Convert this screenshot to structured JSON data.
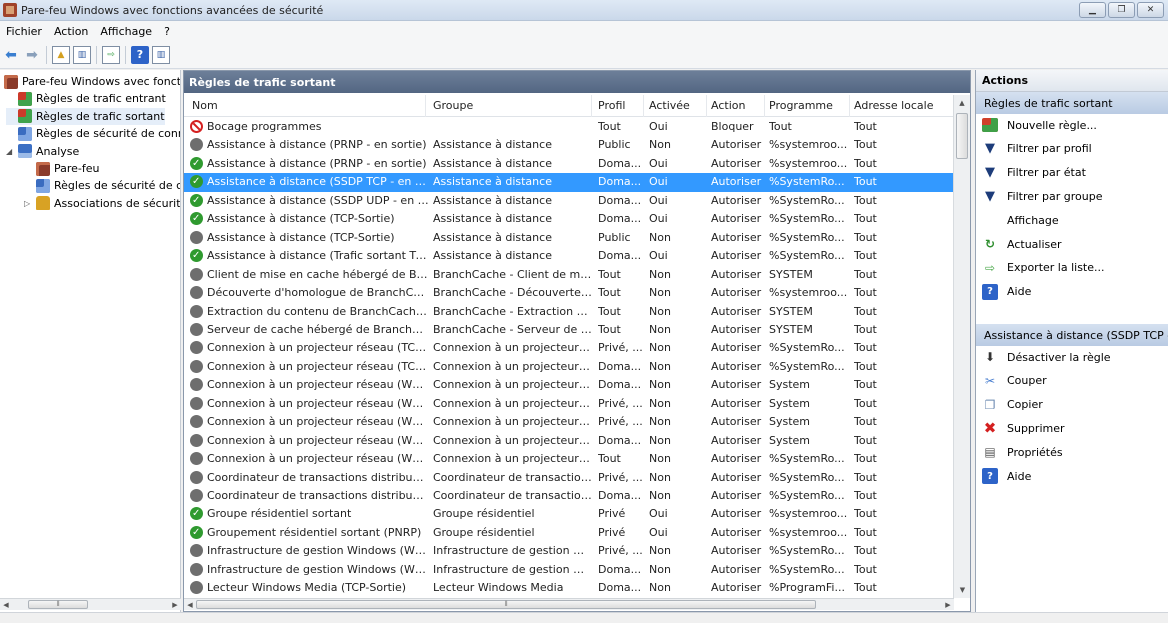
{
  "window": {
    "title": "Pare-feu Windows avec fonctions avancées de sécurité"
  },
  "menu": [
    "Fichier",
    "Action",
    "Affichage",
    "?"
  ],
  "tree": [
    {
      "label": "Pare-feu Windows avec fonctio",
      "icon": "firewall-icon",
      "level": 0,
      "expander": ""
    },
    {
      "label": "Règles de trafic entrant",
      "icon": "inbound-rules-icon",
      "level": 1,
      "expander": ""
    },
    {
      "label": "Règles de trafic sortant",
      "icon": "outbound-rules-icon",
      "level": 1,
      "expander": "",
      "selected": true
    },
    {
      "label": "Règles de sécurité de conne",
      "icon": "connection-security-icon",
      "level": 1,
      "expander": ""
    },
    {
      "label": "Analyse",
      "icon": "monitoring-icon",
      "level": 1,
      "expander": "◢"
    },
    {
      "label": "Pare-feu",
      "icon": "firewall-icon",
      "level": 2,
      "expander": ""
    },
    {
      "label": "Règles de sécurité de co",
      "icon": "connection-security-icon",
      "level": 2,
      "expander": ""
    },
    {
      "label": "Associations de sécurité",
      "icon": "lock-icon",
      "level": 2,
      "expander": "▷"
    }
  ],
  "center": {
    "title": "Règles de trafic sortant",
    "columns": [
      "Nom",
      "Groupe",
      "Profil",
      "Activée",
      "Action",
      "Programme",
      "Adresse locale"
    ],
    "rows": [
      {
        "status": "block",
        "name": "Bocage programmes",
        "group": "",
        "profile": "Tout",
        "enabled": "Oui",
        "action": "Bloquer",
        "program": "Tout",
        "local": "Tout"
      },
      {
        "status": "off",
        "name": "Assistance à distance (PRNP - en sortie)",
        "group": "Assistance à distance",
        "profile": "Public",
        "enabled": "Non",
        "action": "Autoriser",
        "program": "%systemroo...",
        "local": "Tout"
      },
      {
        "status": "on",
        "name": "Assistance à distance (PRNP - en sortie)",
        "group": "Assistance à distance",
        "profile": "Doma...",
        "enabled": "Oui",
        "action": "Autoriser",
        "program": "%systemroo...",
        "local": "Tout"
      },
      {
        "status": "on",
        "name": "Assistance à distance (SSDP TCP - en sort...",
        "group": "Assistance à distance",
        "profile": "Doma...",
        "enabled": "Oui",
        "action": "Autoriser",
        "program": "%SystemRo...",
        "local": "Tout",
        "selected": true
      },
      {
        "status": "on",
        "name": "Assistance à distance (SSDP UDP - en sor...",
        "group": "Assistance à distance",
        "profile": "Doma...",
        "enabled": "Oui",
        "action": "Autoriser",
        "program": "%SystemRo...",
        "local": "Tout"
      },
      {
        "status": "on",
        "name": "Assistance à distance (TCP-Sortie)",
        "group": "Assistance à distance",
        "profile": "Doma...",
        "enabled": "Oui",
        "action": "Autoriser",
        "program": "%SystemRo...",
        "local": "Tout"
      },
      {
        "status": "off",
        "name": "Assistance à distance (TCP-Sortie)",
        "group": "Assistance à distance",
        "profile": "Public",
        "enabled": "Non",
        "action": "Autoriser",
        "program": "%SystemRo...",
        "local": "Tout"
      },
      {
        "status": "on",
        "name": "Assistance à distance (Trafic sortant TCP ...",
        "group": "Assistance à distance",
        "profile": "Doma...",
        "enabled": "Oui",
        "action": "Autoriser",
        "program": "%SystemRo...",
        "local": "Tout"
      },
      {
        "status": "off",
        "name": "Client de mise en cache hébergé de Bran...",
        "group": "BranchCache - Client de mi...",
        "profile": "Tout",
        "enabled": "Non",
        "action": "Autoriser",
        "program": "SYSTEM",
        "local": "Tout"
      },
      {
        "status": "off",
        "name": "Découverte d'homologue de BranchCac...",
        "group": "BranchCache - Découverte ...",
        "profile": "Tout",
        "enabled": "Non",
        "action": "Autoriser",
        "program": "%systemroo...",
        "local": "Tout"
      },
      {
        "status": "off",
        "name": "Extraction du contenu de BranchCache (...",
        "group": "BranchCache - Extraction d...",
        "profile": "Tout",
        "enabled": "Non",
        "action": "Autoriser",
        "program": "SYSTEM",
        "local": "Tout"
      },
      {
        "status": "off",
        "name": "Serveur de cache hébergé de BranchCac...",
        "group": "BranchCache - Serveur de c...",
        "profile": "Tout",
        "enabled": "Non",
        "action": "Autoriser",
        "program": "SYSTEM",
        "local": "Tout"
      },
      {
        "status": "off",
        "name": "Connexion à un projecteur réseau (TCP-S...",
        "group": "Connexion à un projecteur r...",
        "profile": "Privé, ...",
        "enabled": "Non",
        "action": "Autoriser",
        "program": "%SystemRo...",
        "local": "Tout"
      },
      {
        "status": "off",
        "name": "Connexion à un projecteur réseau (TCP-S...",
        "group": "Connexion à un projecteur r...",
        "profile": "Doma...",
        "enabled": "Non",
        "action": "Autoriser",
        "program": "%SystemRo...",
        "local": "Tout"
      },
      {
        "status": "off",
        "name": "Connexion à un projecteur réseau (WSD ...",
        "group": "Connexion à un projecteur r...",
        "profile": "Doma...",
        "enabled": "Non",
        "action": "Autoriser",
        "program": "System",
        "local": "Tout"
      },
      {
        "status": "off",
        "name": "Connexion à un projecteur réseau (WSD ...",
        "group": "Connexion à un projecteur r...",
        "profile": "Privé, ...",
        "enabled": "Non",
        "action": "Autoriser",
        "program": "System",
        "local": "Tout"
      },
      {
        "status": "off",
        "name": "Connexion à un projecteur réseau (WSD ...",
        "group": "Connexion à un projecteur r...",
        "profile": "Privé, ...",
        "enabled": "Non",
        "action": "Autoriser",
        "program": "System",
        "local": "Tout"
      },
      {
        "status": "off",
        "name": "Connexion à un projecteur réseau (WSD ...",
        "group": "Connexion à un projecteur r...",
        "profile": "Doma...",
        "enabled": "Non",
        "action": "Autoriser",
        "program": "System",
        "local": "Tout"
      },
      {
        "status": "off",
        "name": "Connexion à un projecteur réseau (WSD-...",
        "group": "Connexion à un projecteur r...",
        "profile": "Tout",
        "enabled": "Non",
        "action": "Autoriser",
        "program": "%SystemRo...",
        "local": "Tout"
      },
      {
        "status": "off",
        "name": "Coordinateur de transactions distribuées ...",
        "group": "Coordinateur de transaction...",
        "profile": "Privé, ...",
        "enabled": "Non",
        "action": "Autoriser",
        "program": "%SystemRo...",
        "local": "Tout"
      },
      {
        "status": "off",
        "name": "Coordinateur de transactions distribuées ...",
        "group": "Coordinateur de transaction...",
        "profile": "Doma...",
        "enabled": "Non",
        "action": "Autoriser",
        "program": "%SystemRo...",
        "local": "Tout"
      },
      {
        "status": "on",
        "name": "Groupe résidentiel sortant",
        "group": "Groupe résidentiel",
        "profile": "Privé",
        "enabled": "Oui",
        "action": "Autoriser",
        "program": "%systemroo...",
        "local": "Tout"
      },
      {
        "status": "on",
        "name": "Groupement résidentiel sortant (PNRP)",
        "group": "Groupe résidentiel",
        "profile": "Privé",
        "enabled": "Oui",
        "action": "Autoriser",
        "program": "%systemroo...",
        "local": "Tout"
      },
      {
        "status": "off",
        "name": "Infrastructure de gestion Windows (WMI...",
        "group": "Infrastructure de gestion Wi...",
        "profile": "Privé, ...",
        "enabled": "Non",
        "action": "Autoriser",
        "program": "%SystemRo...",
        "local": "Tout"
      },
      {
        "status": "off",
        "name": "Infrastructure de gestion Windows (WMI...",
        "group": "Infrastructure de gestion Wi...",
        "profile": "Doma...",
        "enabled": "Non",
        "action": "Autoriser",
        "program": "%SystemRo...",
        "local": "Tout"
      },
      {
        "status": "off",
        "name": "Lecteur Windows Media (TCP-Sortie)",
        "group": "Lecteur Windows Media",
        "profile": "Doma...",
        "enabled": "Non",
        "action": "Autoriser",
        "program": "%ProgramFi...",
        "local": "Tout"
      }
    ]
  },
  "actions": {
    "title": "Actions",
    "section1": "Règles de trafic sortant",
    "items1": [
      {
        "label": "Nouvelle règle...",
        "icon": "new-rule-icon",
        "glyph": ""
      },
      {
        "label": "Filtrer par profil",
        "icon": "filter-icon",
        "glyph": "▼"
      },
      {
        "label": "Filtrer par état",
        "icon": "filter-icon",
        "glyph": "▼"
      },
      {
        "label": "Filtrer par groupe",
        "icon": "filter-icon",
        "glyph": "▼"
      },
      {
        "label": "Affichage",
        "icon": "view-icon",
        "glyph": ""
      },
      {
        "label": "Actualiser",
        "icon": "refresh-icon",
        "glyph": "↻"
      },
      {
        "label": "Exporter la liste...",
        "icon": "export-icon",
        "glyph": "⇨"
      },
      {
        "label": "Aide",
        "icon": "help-icon",
        "glyph": "?"
      }
    ],
    "section2": "Assistance à distance (SSDP TCP - ...",
    "items2": [
      {
        "label": "Désactiver la règle",
        "icon": "disable-icon",
        "glyph": "⬇"
      },
      {
        "label": "Couper",
        "icon": "cut-icon",
        "glyph": "✂"
      },
      {
        "label": "Copier",
        "icon": "copy-icon",
        "glyph": "❐"
      },
      {
        "label": "Supprimer",
        "icon": "delete-icon",
        "glyph": "✖"
      },
      {
        "label": "Propriétés",
        "icon": "properties-icon",
        "glyph": "▤"
      },
      {
        "label": "Aide",
        "icon": "help-icon",
        "glyph": "?"
      }
    ]
  }
}
